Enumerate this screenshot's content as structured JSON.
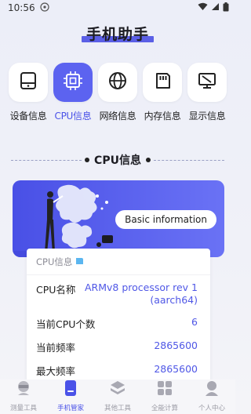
{
  "status_bar": {
    "time": "10:56"
  },
  "header": {
    "title": "手机助手"
  },
  "tabs": [
    {
      "label": "设备信息",
      "icon": "device-icon"
    },
    {
      "label": "CPU信息",
      "icon": "cpu-icon",
      "active": true
    },
    {
      "label": "网络信息",
      "icon": "globe-icon"
    },
    {
      "label": "内存信息",
      "icon": "memory-card-icon"
    },
    {
      "label": "显示信息",
      "icon": "display-icon"
    }
  ],
  "section": {
    "title": "CPU信息"
  },
  "banner": {
    "button_label": "Basic information"
  },
  "card": {
    "heading": "CPU信息",
    "rows": [
      {
        "label": "CPU名称",
        "value": "ARMv8 processor rev 1 (aarch64)"
      },
      {
        "label": "当前CPU个数",
        "value": "6"
      },
      {
        "label": "当前频率",
        "value": "2865600"
      },
      {
        "label": "最大频率",
        "value": "2865600"
      }
    ]
  },
  "bottom_nav": [
    {
      "label": "测量工具",
      "icon": "ruler-person-icon"
    },
    {
      "label": "手机管家",
      "icon": "phone-icon",
      "active": true
    },
    {
      "label": "其他工具",
      "icon": "layers-icon"
    },
    {
      "label": "全能计算",
      "icon": "calculator-icon"
    },
    {
      "label": "个人中心",
      "icon": "user-icon"
    }
  ],
  "colors": {
    "accent": "#5c63f0",
    "accent_text": "#4a52e8",
    "background": "#eceef8"
  }
}
